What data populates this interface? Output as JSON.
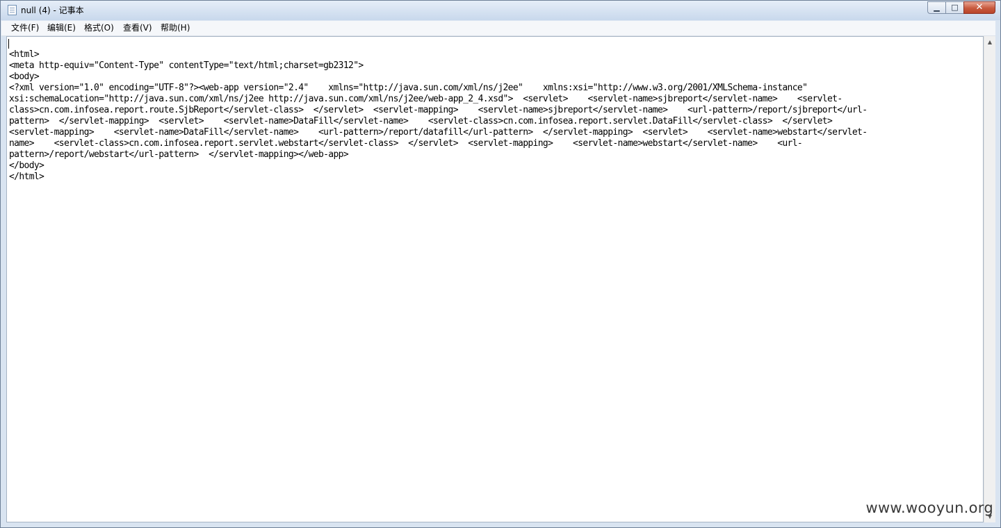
{
  "window": {
    "title": "null (4) - 记事本",
    "icon": "notepad-icon",
    "controls": {
      "minimize": "▁",
      "maximize": "□",
      "close": "✕"
    }
  },
  "menu": {
    "file": "文件(F)",
    "edit": "编辑(E)",
    "format": "格式(O)",
    "view": "查看(V)",
    "help": "帮助(H)"
  },
  "editor": {
    "content": "\n<html>\n<meta http-equiv=\"Content-Type\" contentType=\"text/html;charset=gb2312\">\n<body>\n<?xml version=\"1.0\" encoding=\"UTF-8\"?><web-app version=\"2.4\"    xmlns=\"http://java.sun.com/xml/ns/j2ee\"    xmlns:xsi=\"http://www.w3.org/2001/XMLSchema-instance\"\nxsi:schemaLocation=\"http://java.sun.com/xml/ns/j2ee http://java.sun.com/xml/ns/j2ee/web-app_2_4.xsd\">  <servlet>    <servlet-name>sjbreport</servlet-name>    <servlet-\nclass>cn.com.infosea.report.route.SjbReport</servlet-class>  </servlet>  <servlet-mapping>    <servlet-name>sjbreport</servlet-name>    <url-pattern>/report/sjbreport</url-\npattern>  </servlet-mapping>  <servlet>    <servlet-name>DataFill</servlet-name>    <servlet-class>cn.com.infosea.report.servlet.DataFill</servlet-class>  </servlet>\n<servlet-mapping>    <servlet-name>DataFill</servlet-name>    <url-pattern>/report/datafill</url-pattern>  </servlet-mapping>  <servlet>    <servlet-name>webstart</servlet-\nname>    <servlet-class>cn.com.infosea.report.servlet.webstart</servlet-class>  </servlet>  <servlet-mapping>    <servlet-name>webstart</servlet-name>    <url-\npattern>/report/webstart</url-pattern>  </servlet-mapping></web-app>\n</body>\n</html>"
  },
  "scrollbar": {
    "up": "▲",
    "down": "▼"
  },
  "watermark": "www.wooyun.org"
}
